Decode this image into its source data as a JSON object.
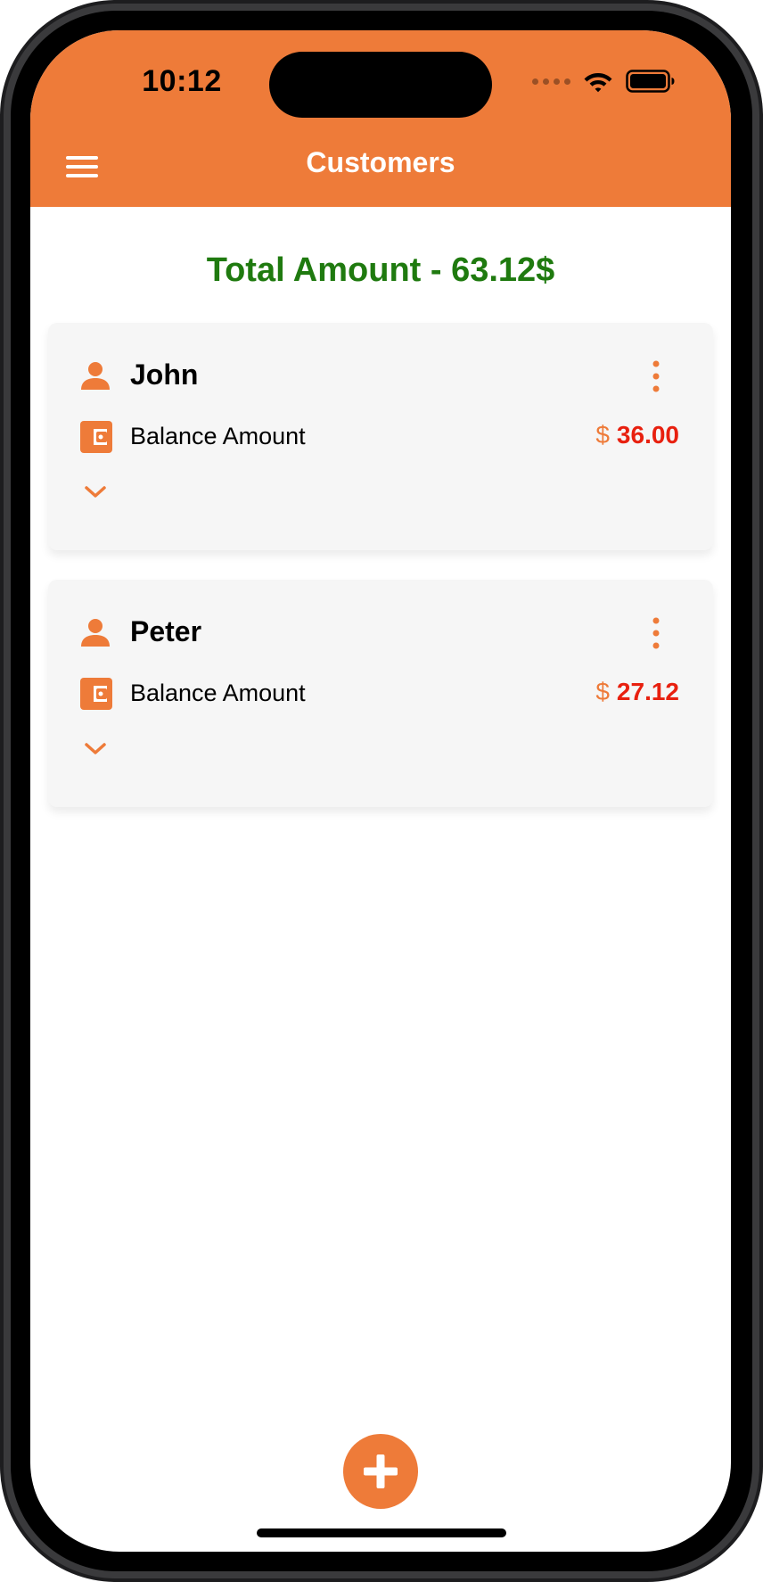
{
  "status_bar": {
    "time": "10:12"
  },
  "header": {
    "title": "Customers",
    "menu_icon": "hamburger-menu-icon"
  },
  "summary": {
    "total_label": "Total Amount - 63.12$"
  },
  "customers": [
    {
      "name": "John",
      "balance_label": "Balance Amount",
      "currency_symbol": "$",
      "balance_value": "36.00"
    },
    {
      "name": "Peter",
      "balance_label": "Balance Amount",
      "currency_symbol": "$",
      "balance_value": "27.12"
    }
  ],
  "icons": {
    "customer": "person-icon",
    "wallet": "wallet-icon",
    "more": "more-vertical-icon",
    "expand": "chevron-down-icon",
    "add": "plus-icon"
  },
  "colors": {
    "accent": "#ee7b39",
    "total_amount": "#1f7a0f",
    "balance_value": "#e8200f",
    "card_background": "#f6f6f6"
  }
}
